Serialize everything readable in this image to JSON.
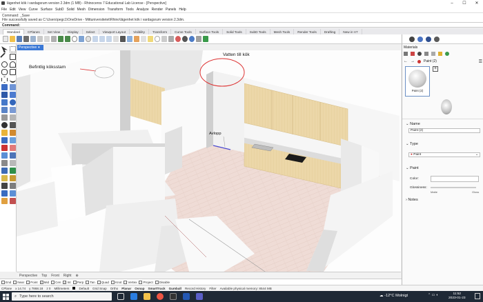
{
  "window": {
    "title": "lägenhet kök i vardagsrum version 2.3dm (1 MB) - Rhinoceros 7 Educational Lab License - [Perspective]",
    "minimize": "–",
    "maximize": "☐",
    "close": "✕"
  },
  "menu": [
    "File",
    "Edit",
    "View",
    "Curve",
    "Surface",
    "SubD",
    "Solid",
    "Mesh",
    "Dimension",
    "Transform",
    "Tools",
    "Analyze",
    "Render",
    "Panels",
    "Help"
  ],
  "command_history": {
    "line1": "Command: _Save",
    "line2": "File successfully saved as C:\\Users\\pegc1\\OneDrive - Mittuniversitetet\\Rhino\\lägenhet kök i vardagsrum version 2.3dm."
  },
  "command_prompt": "Command:",
  "toolbar_tabs": [
    "Standard",
    "CPlanes",
    "Set View",
    "Display",
    "Select",
    "Viewport Layout",
    "Visibility",
    "Transform",
    "Curve Tools",
    "Surface Tools",
    "Solid Tools",
    "SubD Tools",
    "Mesh Tools",
    "Render Tools",
    "Drafting",
    "New in V7"
  ],
  "viewport": {
    "active_tab": "Perspective",
    "labels": {
      "existing": "Befintlig köksstam",
      "water": "Vatten till kök",
      "drain": "Avlopp"
    },
    "bottom_tabs": [
      "Perspective",
      "Top",
      "Front",
      "Right"
    ]
  },
  "osnaps": [
    {
      "label": "End",
      "checked": false
    },
    {
      "label": "Near",
      "checked": false
    },
    {
      "label": "Point",
      "checked": false
    },
    {
      "label": "Mid",
      "checked": true
    },
    {
      "label": "Cen",
      "checked": false
    },
    {
      "label": "Int",
      "checked": true
    },
    {
      "label": "Perp",
      "checked": false
    },
    {
      "label": "Tan",
      "checked": false
    },
    {
      "label": "Quad",
      "checked": false
    },
    {
      "label": "Knot",
      "checked": false
    },
    {
      "label": "Vertex",
      "checked": false
    },
    {
      "label": "Project",
      "checked": false
    },
    {
      "label": "Disable",
      "checked": false
    }
  ],
  "status": {
    "cplane": "CPlane",
    "x": "x 14.74",
    "y": "y 7868.18",
    "z": "z 0",
    "units": "Millimeters",
    "layer": "Default",
    "grid_snap": "Grid Snap",
    "ortho": "Ortho",
    "planar": "Planar",
    "osnap": "Osnap",
    "smarttrack": "SmartTrack",
    "gumball": "Gumball",
    "record_history": "Record History",
    "filter": "Filter",
    "memory": "Available physical memory: 8544 MB"
  },
  "materials_panel": {
    "title": "Materials",
    "material_name": "Paint (2)",
    "sections": {
      "name": "Name",
      "type": "Type",
      "paint": "Paint",
      "notes": "Notes"
    },
    "name_value": "Paint (2)",
    "type_value": "Paint",
    "color_label": "Color:",
    "glossiness_label": "Glossiness:",
    "matte": "Matte",
    "gloss": "Gloss"
  },
  "taskbar": {
    "search_placeholder": "Type here to search",
    "weather": "-12°C Molnigt",
    "time": "11:52",
    "date": "2023-01-23"
  }
}
